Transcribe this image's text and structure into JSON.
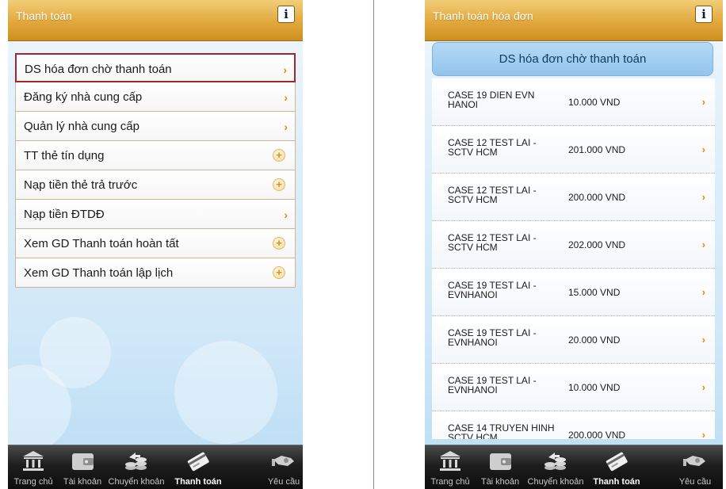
{
  "left_screen": {
    "header_title": "Thanh toán",
    "info_label": "i",
    "menu": [
      {
        "label": "DS hóa đơn chờ thanh toán",
        "indicator": "chevron",
        "selected": true
      },
      {
        "label": "Đăng ký nhà cung cấp",
        "indicator": "chevron"
      },
      {
        "label": "Quản lý nhà cung cấp",
        "indicator": "chevron"
      },
      {
        "label": "TT thẻ tín dụng",
        "indicator": "plus"
      },
      {
        "label": "Nạp tiền thẻ trả trước",
        "indicator": "plus"
      },
      {
        "label": "Nạp tiền ĐTDĐ",
        "indicator": "chevron"
      },
      {
        "label": "Xem GD Thanh toán hoàn tất",
        "indicator": "plus"
      },
      {
        "label": "Xem GD Thanh toán lập lịch",
        "indicator": "plus"
      }
    ]
  },
  "right_screen": {
    "header_title": "Thanh toán hóa đơn",
    "info_label": "i",
    "list_title": "DS hóa đơn chờ thanh toán",
    "bills": [
      {
        "name": "CASE 19 DIEN EVN HANOI",
        "amount": "10.000 VND"
      },
      {
        "name": "CASE 12 TEST LAI - SCTV HCM",
        "amount": "201.000 VND"
      },
      {
        "name": "CASE 12 TEST LAI - SCTV HCM",
        "amount": "200.000 VND"
      },
      {
        "name": "CASE 12 TEST LAI - SCTV HCM",
        "amount": "202.000 VND"
      },
      {
        "name": "CASE 19 TEST LAI - EVNHANOI",
        "amount": "15.000 VND"
      },
      {
        "name": "CASE 19 TEST LAI - EVNHANOI",
        "amount": "20.000 VND"
      },
      {
        "name": "CASE 19 TEST LAI - EVNHANOI",
        "amount": "10.000 VND"
      },
      {
        "name": "CASE 14 TRUYEN HINH SCTV HCM",
        "amount": "200.000 VND"
      }
    ]
  },
  "tabbar": {
    "active": "payment",
    "tabs": [
      {
        "id": "home",
        "label": "Trang chủ",
        "icon": "bank-icon"
      },
      {
        "id": "account",
        "label": "Tài khoản",
        "icon": "wallet-icon"
      },
      {
        "id": "transfer",
        "label": "Chuyển khoản",
        "icon": "transfer-coins-icon"
      },
      {
        "id": "payment",
        "label": "Thanh toán",
        "icon": "payment-card-icon"
      },
      {
        "id": "request",
        "label": "Yêu cầu",
        "icon": "request-hand-icon"
      }
    ]
  },
  "colors": {
    "header_gold": "#e1a83c",
    "selected_border": "#a2262a",
    "chevron_orange": "#e08b10",
    "list_header_blue": "#93c4ec",
    "tabbar_dark": "#1e1e1e"
  }
}
